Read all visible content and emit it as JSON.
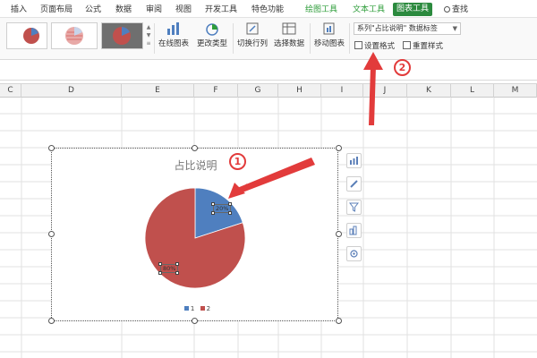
{
  "ribbon_tabs": [
    {
      "label": "插入"
    },
    {
      "label": "页面布局"
    },
    {
      "label": "公式"
    },
    {
      "label": "数据"
    },
    {
      "label": "审阅"
    },
    {
      "label": "视图"
    },
    {
      "label": "开发工具"
    },
    {
      "label": "特色功能"
    },
    {
      "label": "绘图工具"
    },
    {
      "label": "文本工具"
    },
    {
      "label": "图表工具"
    },
    {
      "label": "查找"
    }
  ],
  "ribbon": {
    "online_chart": "在线图表",
    "change_type": "更改类型",
    "switch_row_col": "切换行列",
    "select_data": "选择数据",
    "move_chart": "移动图表",
    "series_select": "系列\"占比说明\" 数据标签",
    "set_format": "设置格式",
    "reset_style": "重置样式"
  },
  "columns": [
    "C",
    "D",
    "E",
    "F",
    "G",
    "H",
    "I",
    "J",
    "K",
    "L",
    "M"
  ],
  "colors": {
    "accent_green": "#2b8a3e",
    "annotation_red": "#e23b3b",
    "slice_blue": "#4f7fbf",
    "slice_red": "#c0504d"
  },
  "chart_data": {
    "type": "pie",
    "title": "占比说明",
    "categories": [
      "1",
      "2"
    ],
    "values": [
      20,
      80
    ],
    "data_labels": [
      "20%",
      "80%"
    ],
    "colors": [
      "#4f7fbf",
      "#c0504d"
    ],
    "legend_position": "bottom"
  },
  "annotations": {
    "badge1": "1",
    "badge2": "2"
  },
  "side_tools": [
    "chart-elements-icon",
    "chart-style-icon",
    "chart-filter-icon",
    "chart-layout-icon",
    "chart-settings-icon"
  ]
}
